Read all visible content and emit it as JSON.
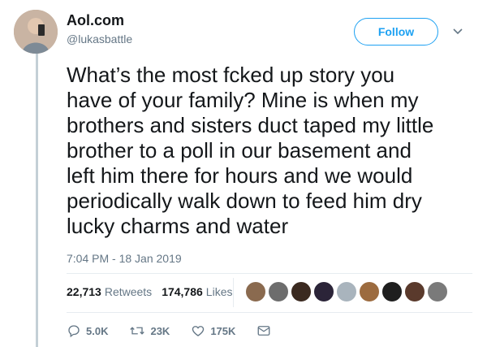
{
  "account": {
    "display_name": "Aol.com",
    "handle": "@lukasbattle"
  },
  "follow_label": "Follow",
  "tweet": {
    "text": "What’s the most fcked up story you\nhave of your family? Mine is when my\nbrothers and sisters duct taped my little\nbrother to a poll in our basement and\nleft him there for hours and we would\nperiodically walk down to feed him dry\nlucky charms and water",
    "timestamp": "7:04 PM - 18 Jan 2019"
  },
  "stats": {
    "retweets": "22,713",
    "retweets_label": "Retweets",
    "likes": "174,786",
    "likes_label": "Likes",
    "liker_avatar_colors": [
      "#8a6a4f",
      "#6d6d6d",
      "#3b2a20",
      "#2b2438",
      "#a9b4bd",
      "#9c6b3f",
      "#1f1f1f",
      "#5a3a2c",
      "#7a7a7a"
    ]
  },
  "actions": {
    "replies": "5.0K",
    "retweets": "23K",
    "likes": "175K"
  },
  "colors": {
    "accent": "#1da1f2",
    "muted": "#657786",
    "text": "#14171a"
  }
}
